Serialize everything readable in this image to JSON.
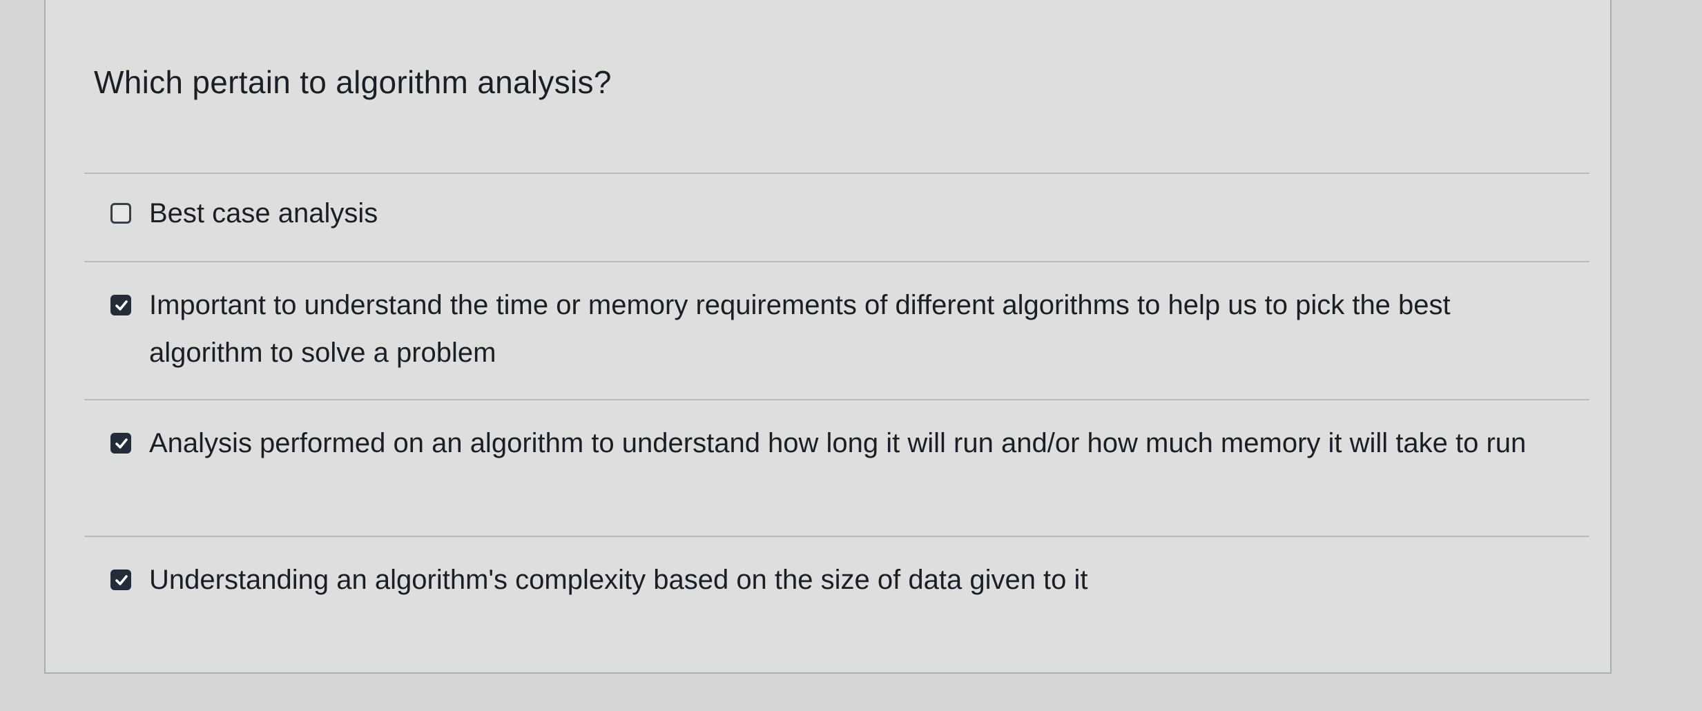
{
  "question": {
    "prompt": "Which pertain to algorithm analysis?"
  },
  "answers": [
    {
      "label": "Best case analysis",
      "checked": false
    },
    {
      "label": "Important to understand the time or memory requirements of different algorithms to help us to pick the best algorithm to solve a problem",
      "checked": true
    },
    {
      "label": "Analysis performed on an algorithm to understand how long it will run and/or how much memory it will take to run",
      "checked": true
    },
    {
      "label": "Understanding an algorithm's complexity based on the size of data given to it",
      "checked": true
    }
  ],
  "colors": {
    "checkbox_checked": "#242c3a",
    "checkmark": "#ffffff",
    "divider": "#b7bbbd"
  }
}
